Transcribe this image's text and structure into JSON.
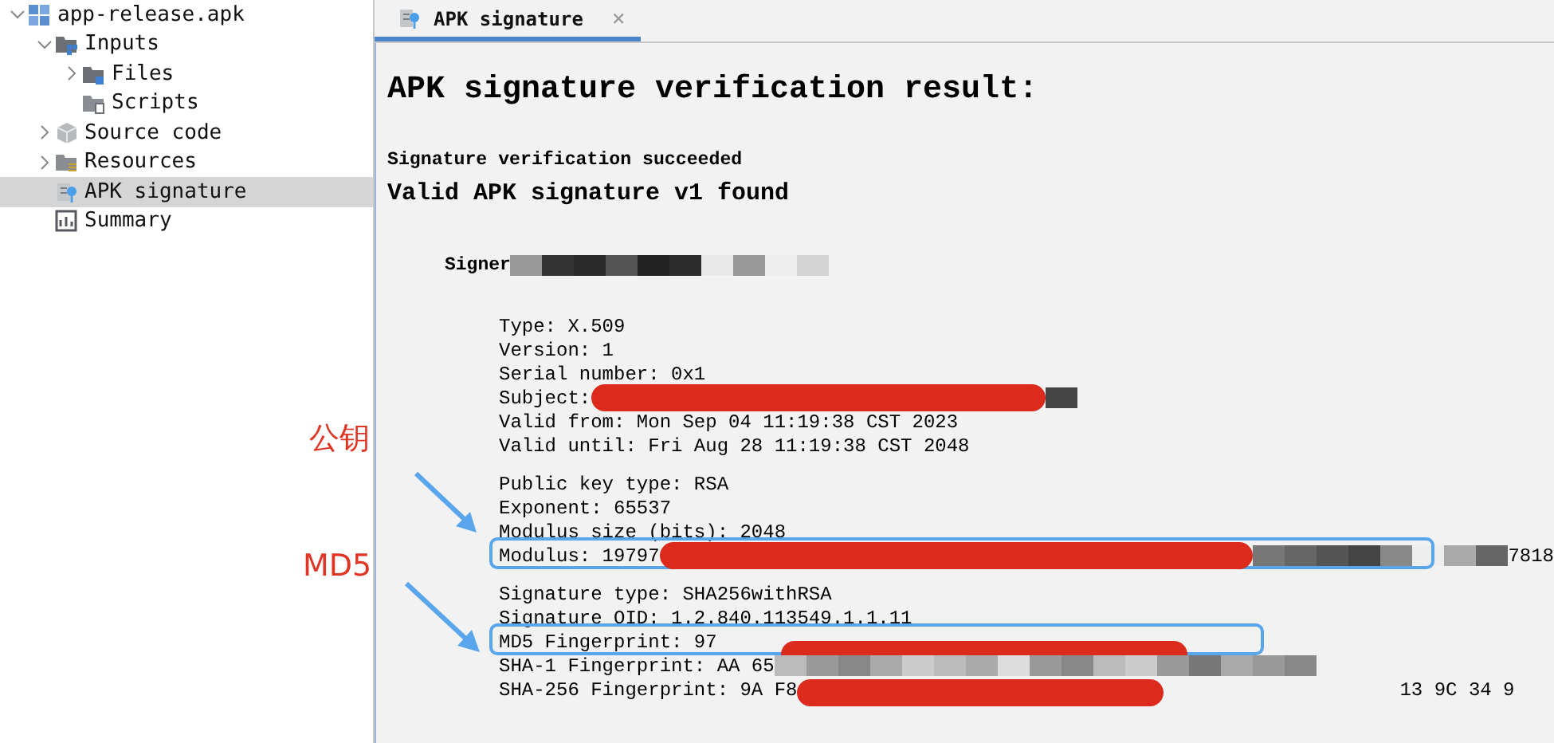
{
  "tree": [
    {
      "label": "app-release.apk",
      "kind": "apk",
      "expanded": true,
      "selected": false,
      "children": [
        {
          "label": "Inputs",
          "kind": "inputs",
          "expanded": true,
          "selected": false,
          "children": [
            {
              "label": "Files",
              "kind": "files",
              "expanded": false,
              "selected": false
            },
            {
              "label": "Scripts",
              "kind": "scripts",
              "selected": false
            }
          ]
        },
        {
          "label": "Source code",
          "kind": "source",
          "expanded": false,
          "selected": false
        },
        {
          "label": "Resources",
          "kind": "resources",
          "expanded": false,
          "selected": false
        },
        {
          "label": "APK signature",
          "kind": "signature",
          "selected": true
        },
        {
          "label": "Summary",
          "kind": "summary",
          "selected": false
        }
      ]
    }
  ],
  "tab": {
    "label": "APK signature",
    "close": "×",
    "selected": true
  },
  "title": "APK signature verification result:",
  "status": "Signature verification succeeded",
  "subtitle": "Valid APK signature v1 found",
  "signer": "Signer",
  "groups": [
    [
      {
        "text": "Type: X.509"
      },
      {
        "text": "Version: 1"
      },
      {
        "text": "Serial number: 0x1"
      },
      {
        "text": "Subject:",
        "kind": "red"
      },
      {
        "text": "Valid from: Mon Sep 04 11:19:38 CST 2023"
      },
      {
        "text": "Valid until: Fri Aug 28 11:19:38 CST 2048"
      }
    ],
    [
      {
        "text": "Public key type: RSA"
      },
      {
        "text": "Exponent: 65537"
      },
      {
        "text": "Modulus size (bits): 2048"
      },
      {
        "text": "Modulus: 19797",
        "kind": "red",
        "tail": "7818",
        "highlighted": true
      }
    ],
    [
      {
        "text": "Signature type: SHA256withRSA"
      },
      {
        "text": "Signature OID: 1.2.840.113549.1.1.11"
      },
      {
        "text": "MD5 Fingerprint: 97",
        "kind": "low",
        "highlighted": true
      },
      {
        "text": "SHA-1 Fingerprint: AA 65",
        "kind": "pixel"
      },
      {
        "text": "SHA-256 Fingerprint: 9A F8",
        "kind": "red",
        "tail": "13 9C 34 9"
      }
    ]
  ],
  "annotations": [
    {
      "label": "公钥"
    },
    {
      "label": "MD5"
    }
  ]
}
